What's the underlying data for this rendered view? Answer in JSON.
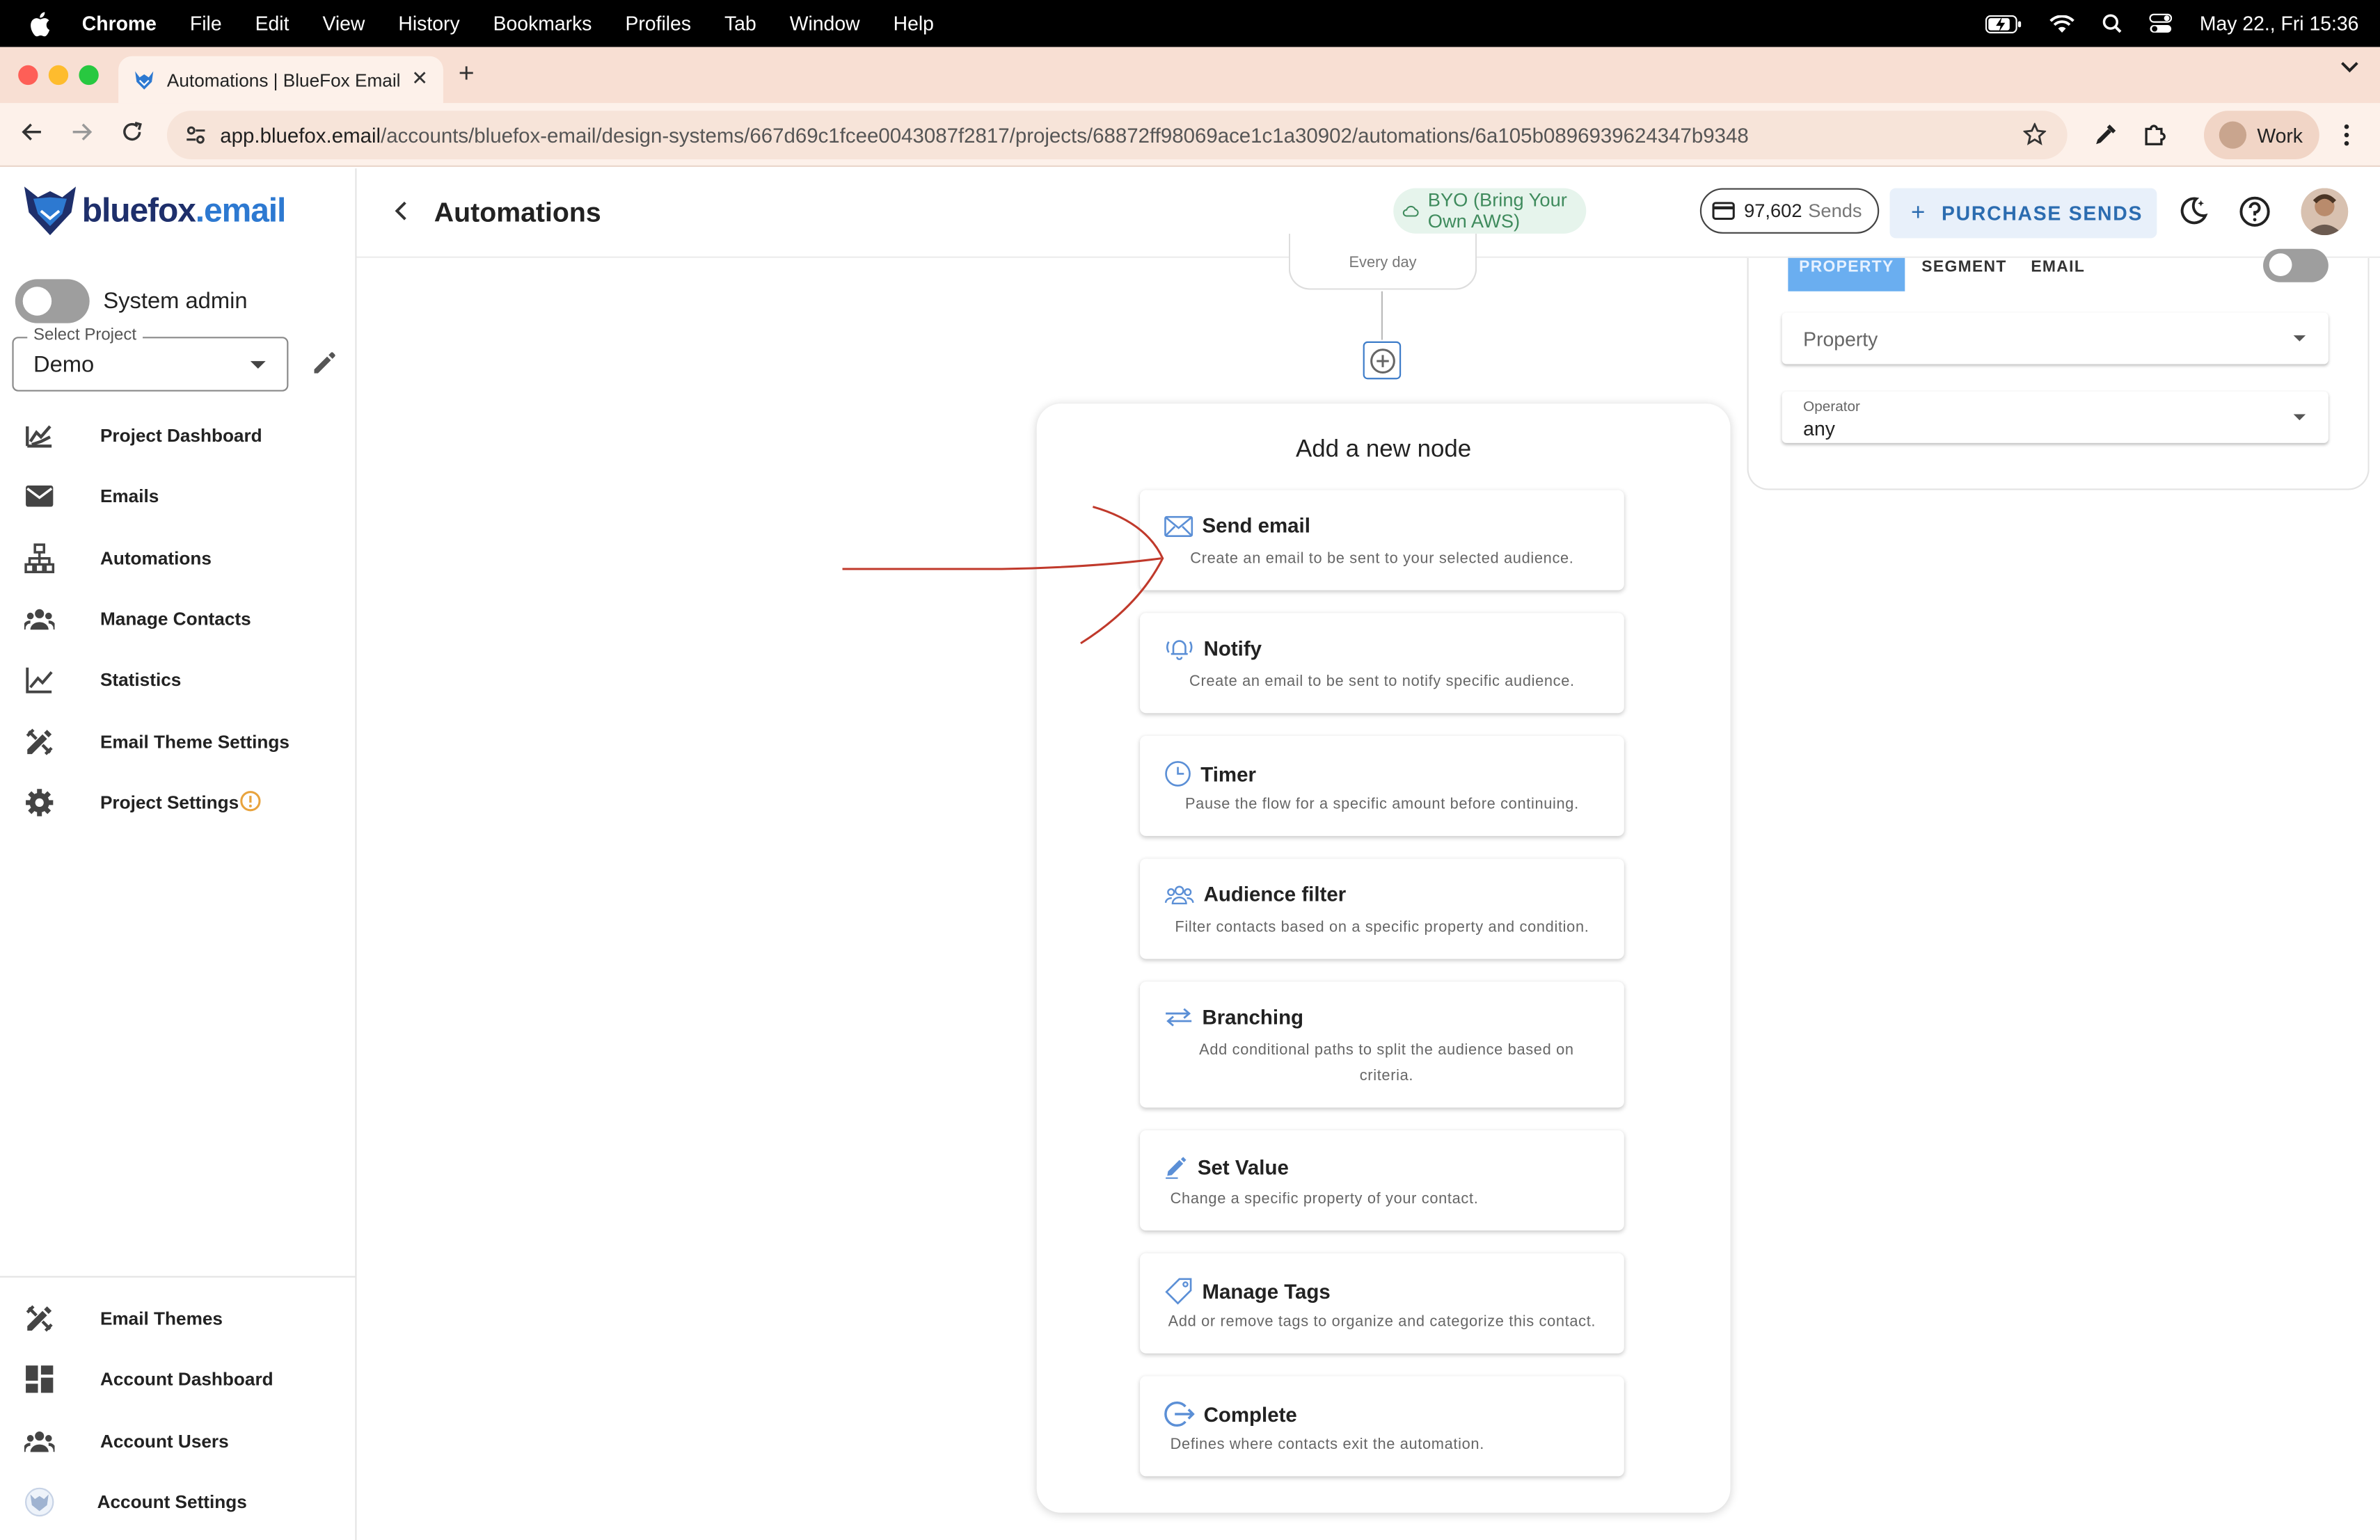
{
  "menubar": {
    "app": "Chrome",
    "items": [
      "File",
      "Edit",
      "View",
      "History",
      "Bookmarks",
      "Profiles",
      "Tab",
      "Window",
      "Help"
    ],
    "datetime": "May 22., Fri 15:36"
  },
  "browser": {
    "tab_title": "Automations | BlueFox Email",
    "url_host": "app.bluefox.email",
    "url_path": "/accounts/bluefox-email/design-systems/667d69c1fcee0043087f2817/projects/68872ff98069ace1c1a30902/automations/6a105b0896939624347b9348",
    "profile_label": "Work"
  },
  "brand": {
    "name_main": "bluefox",
    "name_dot": ".email"
  },
  "sidebar": {
    "system_admin_label": "System admin",
    "select_project_label": "Select Project",
    "project_value": "Demo",
    "items": [
      {
        "label": "Project Dashboard",
        "icon": "dashboard-chart-icon"
      },
      {
        "label": "Emails",
        "icon": "mail-icon"
      },
      {
        "label": "Automations",
        "icon": "sitemap-icon"
      },
      {
        "label": "Manage Contacts",
        "icon": "people-icon"
      },
      {
        "label": "Statistics",
        "icon": "line-chart-icon"
      },
      {
        "label": "Email Theme Settings",
        "icon": "design-tools-icon"
      },
      {
        "label": "Project Settings",
        "icon": "gear-icon"
      }
    ],
    "bottom_items": [
      {
        "label": "Email Themes",
        "icon": "design-tools-icon"
      },
      {
        "label": "Account Dashboard",
        "icon": "grid-icon"
      },
      {
        "label": "Account Users",
        "icon": "people-icon"
      },
      {
        "label": "Account Settings",
        "icon": "logo-icon"
      }
    ]
  },
  "header": {
    "title": "Automations",
    "byo_label": "BYO (Bring Your Own AWS)",
    "sends_count": "97,602",
    "sends_word": "Sends",
    "purchase_label": "PURCHASE SENDS"
  },
  "canvas": {
    "trigger_text": "Every day",
    "panel_title": "Add a new node",
    "nodes": [
      {
        "name": "Send email",
        "desc": "Create an email to be sent to your selected audience.",
        "icon": "envelope-icon"
      },
      {
        "name": "Notify",
        "desc": "Create an email to be sent to notify specific audience.",
        "icon": "bell-ringing-icon"
      },
      {
        "name": "Timer",
        "desc": "Pause the flow for a specific amount before continuing.",
        "icon": "clock-icon"
      },
      {
        "name": "Audience filter",
        "desc": "Filter contacts based on a specific property and condition.",
        "icon": "audience-icon"
      },
      {
        "name": "Branching",
        "desc": "Add conditional paths to split the audience based on criteria.",
        "icon": "swap-arrows-icon"
      },
      {
        "name": "Set Value",
        "desc": "Change a specific property of your contact.",
        "icon": "pencil-icon"
      },
      {
        "name": "Manage Tags",
        "desc": "Add or remove tags to organize and categorize this contact.",
        "icon": "tag-icon"
      },
      {
        "name": "Complete",
        "desc": "Defines where contacts exit the automation.",
        "icon": "exit-icon"
      }
    ]
  },
  "filter_panel": {
    "tabs": [
      "PROPERTY",
      "SEGMENT",
      "EMAIL"
    ],
    "property_placeholder": "Property",
    "operator_label": "Operator",
    "operator_value": "any"
  },
  "colors": {
    "accent_blue": "#2b6cb0",
    "byo_green": "#3f8b5d",
    "tab_active": "#6aaef0",
    "annotation_red": "#c0392b",
    "warning_orange": "#e8a33d"
  }
}
